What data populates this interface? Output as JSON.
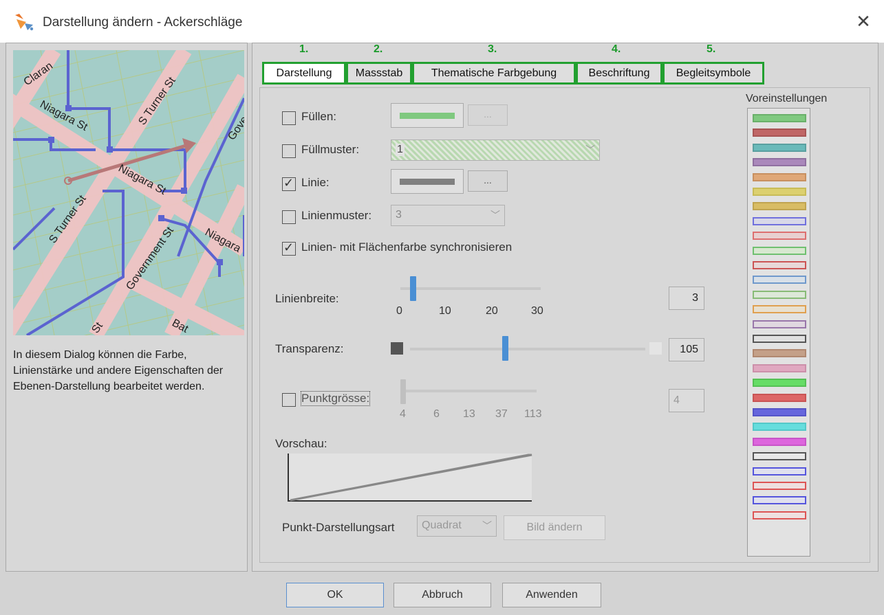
{
  "window": {
    "title": "Darstellung ändern - Ackerschläge",
    "close_glyph": "✕"
  },
  "left": {
    "description": "In diesem Dialog können die Farbe, Linienstärke und andere Eigenschaften der Ebenen-Darstellung bearbeitet werden.",
    "map_labels": [
      "Claran",
      "Niagara St",
      "S Turner St",
      "Gove",
      "Niagara St",
      "S Turner St",
      "Niagara",
      "Government St",
      "St",
      "Bat"
    ]
  },
  "steps": [
    "1.",
    "2.",
    "3.",
    "4.",
    "5."
  ],
  "tabs": [
    {
      "label": "Darstellung",
      "active": true
    },
    {
      "label": "Massstab",
      "active": false
    },
    {
      "label": "Thematische Farbgebung",
      "active": false
    },
    {
      "label": "Beschriftung",
      "active": false
    },
    {
      "label": "Begleitsymbole",
      "active": false
    }
  ],
  "form": {
    "fill_label": "Füllen:",
    "fill_checked": false,
    "fill_color": "#7fc97f",
    "fill_more": "...",
    "pattern_label": "Füllmuster:",
    "pattern_checked": false,
    "pattern_value": "1",
    "line_label": "Linie:",
    "line_checked": true,
    "line_color": "#808080",
    "line_more": "...",
    "linepattern_label": "Linienmuster:",
    "linepattern_checked": false,
    "linepattern_value": "3",
    "sync_label": "Linien- mit Flächenfarbe synchronisieren",
    "sync_checked": true,
    "width_label": "Linienbreite:",
    "width_value": "3",
    "width_ticks": [
      "0",
      "10",
      "20",
      "30"
    ],
    "transparency_label": "Transparenz:",
    "transparency_value": "105",
    "pointsize_label": "Punktgrösse:",
    "pointsize_checked": false,
    "pointsize_value": "4",
    "pointsize_ticks": [
      "4",
      "6",
      "13",
      "37",
      "113"
    ],
    "preview_label": "Vorschau:",
    "pointstyle_label": "Punkt-Darstellungsart",
    "pointstyle_value": "Quadrat",
    "change_image_label": "Bild ändern"
  },
  "presets": {
    "label": "Voreinstellungen",
    "items": [
      {
        "fill": "#7fc97f",
        "border": "#6ab06a"
      },
      {
        "fill": "#c06666",
        "border": "#a85555"
      },
      {
        "fill": "#6ababa",
        "border": "#5aa0a0"
      },
      {
        "fill": "#aa88bb",
        "border": "#9070a0"
      },
      {
        "fill": "#e0a878",
        "border": "#c89060"
      },
      {
        "fill": "#dcd070",
        "border": "#c8bc58"
      },
      {
        "fill": "#d8bc64",
        "border": "#c0a450"
      },
      {
        "fill": "#d8d8e8",
        "border": "#7070dd"
      },
      {
        "fill": "#e8d0d0",
        "border": "#dd7070"
      },
      {
        "fill": "#d8e8d0",
        "border": "#70c070"
      },
      {
        "fill": "#e8d8d8",
        "border": "#cc5555"
      },
      {
        "fill": "#d8e0e8",
        "border": "#7099cc"
      },
      {
        "fill": "#dce8d8",
        "border": "#88bb77"
      },
      {
        "fill": "#e8e0d0",
        "border": "#e0a050"
      },
      {
        "fill": "#e0d8e0",
        "border": "#9977aa"
      },
      {
        "fill": "#e0e0e0",
        "border": "#555555"
      },
      {
        "fill": "#c4a088",
        "border": "#b08870"
      },
      {
        "fill": "#e0a8c0",
        "border": "#cc90aa"
      },
      {
        "fill": "#66dd66",
        "border": "#55c055"
      },
      {
        "fill": "#dd6666",
        "border": "#c85555"
      },
      {
        "fill": "#6666dd",
        "border": "#5555c8"
      },
      {
        "fill": "#66dddd",
        "border": "#55c8c8"
      },
      {
        "fill": "#dd66dd",
        "border": "#c855c8"
      },
      {
        "fill": "#e8e8e8",
        "border": "#555555"
      },
      {
        "fill": "#e0e0ee",
        "border": "#5555dd"
      },
      {
        "fill": "#eee0e0",
        "border": "#dd5555"
      },
      {
        "fill": "#e0e0ee",
        "border": "#5555dd"
      },
      {
        "fill": "#eee0e0",
        "border": "#dd5555"
      }
    ]
  },
  "buttons": {
    "ok": "OK",
    "cancel": "Abbruch",
    "apply": "Anwenden"
  }
}
